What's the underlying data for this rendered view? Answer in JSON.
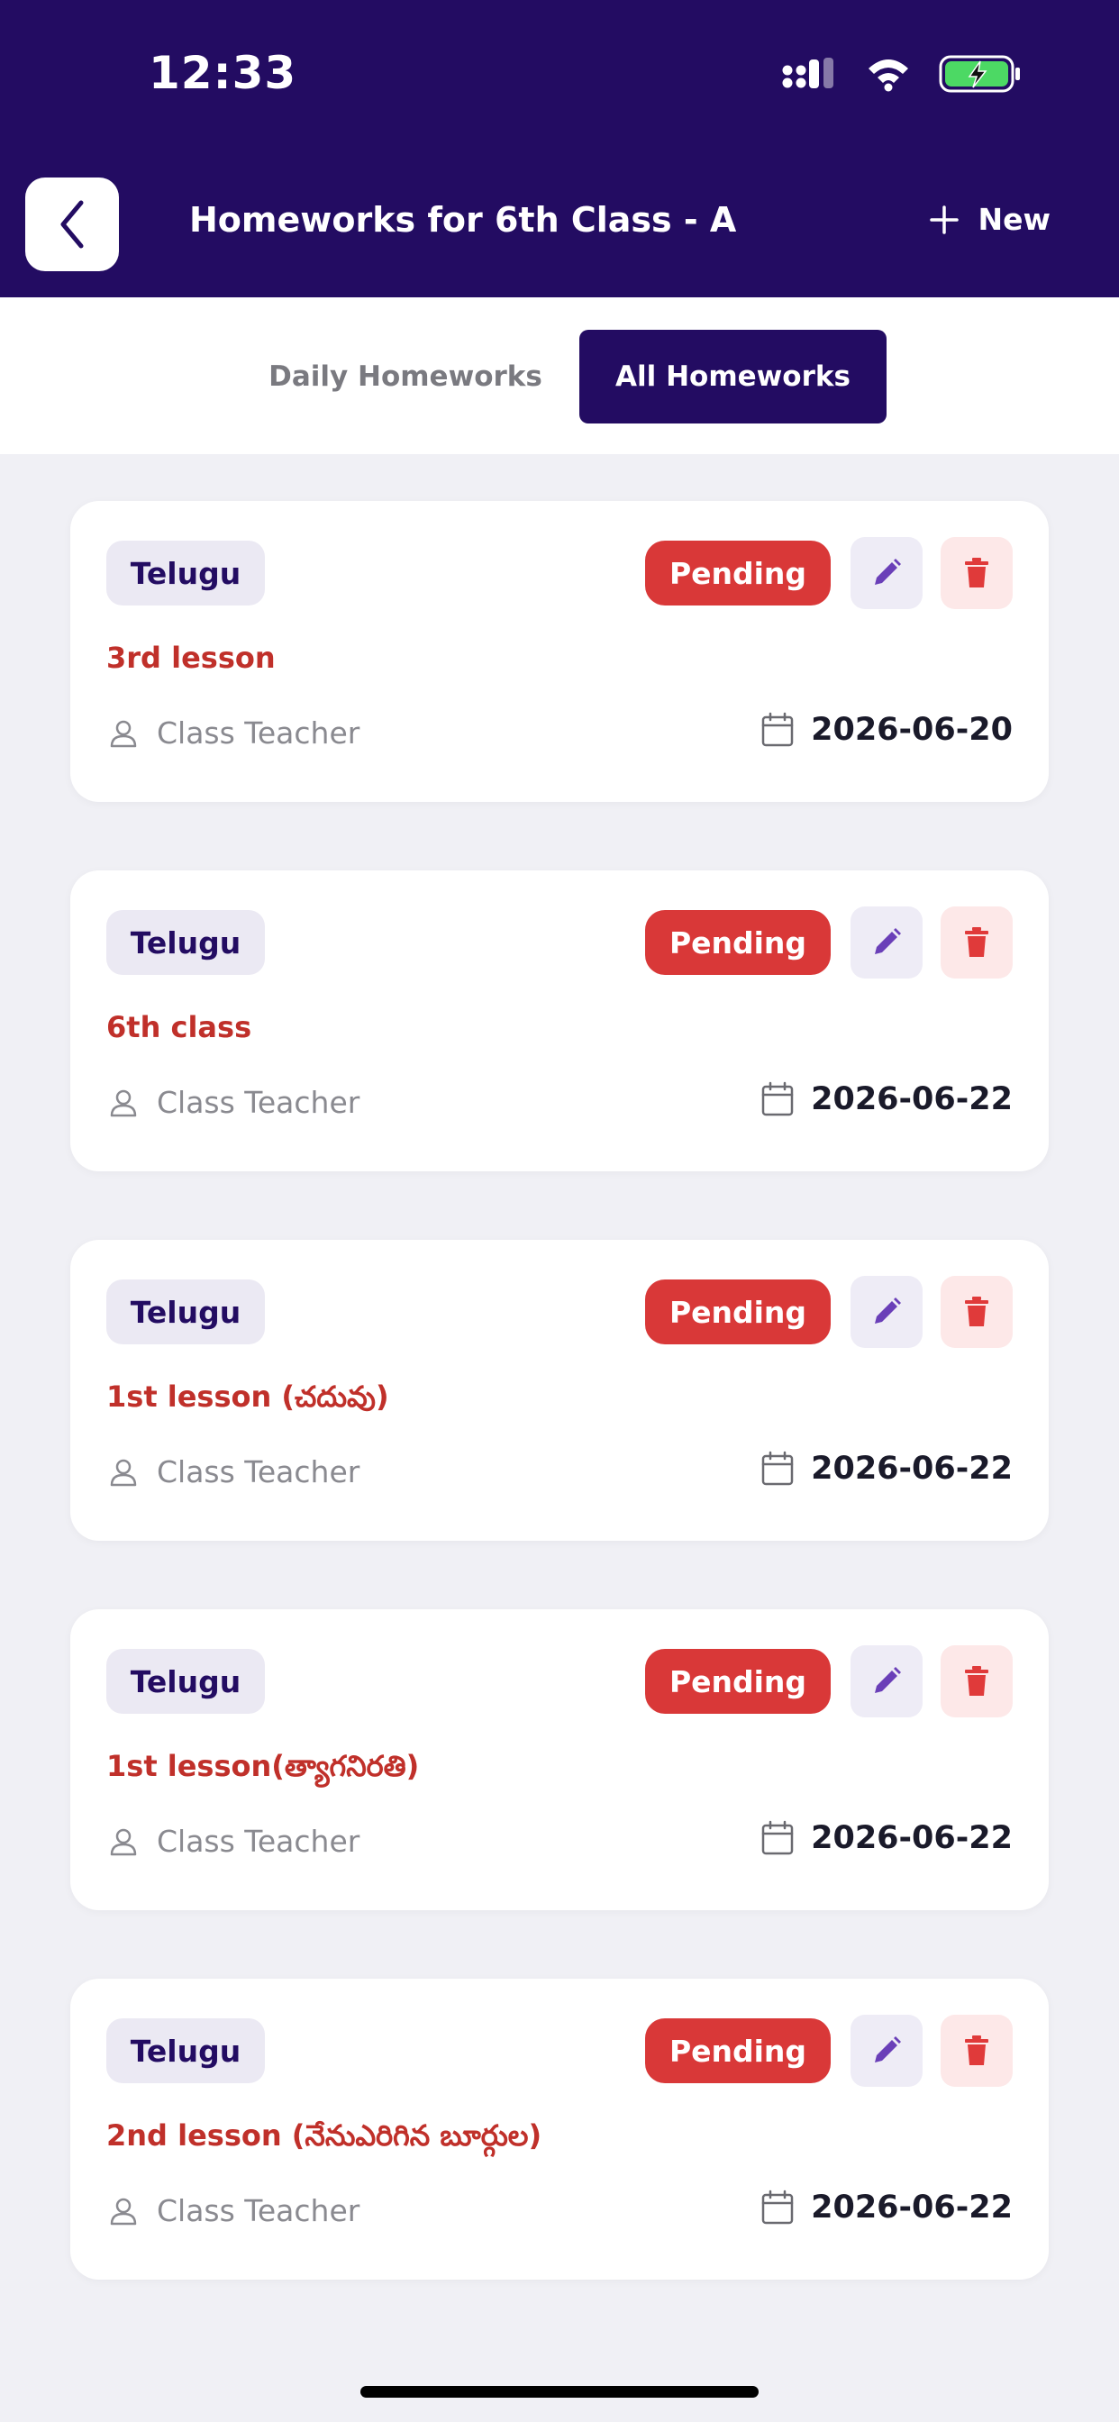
{
  "status_bar": {
    "time": "12:33"
  },
  "header": {
    "title": "Homeworks for 6th Class - A",
    "new_label": "New"
  },
  "tabs": [
    {
      "label": "Daily Homeworks",
      "active": false
    },
    {
      "label": "All Homeworks",
      "active": true
    }
  ],
  "homeworks": [
    {
      "subject": "Telugu",
      "status": "Pending",
      "title": "3rd lesson",
      "assigned_by": "Class Teacher",
      "due_date": "2026-06-20"
    },
    {
      "subject": "Telugu",
      "status": "Pending",
      "title": "6th class",
      "assigned_by": "Class Teacher",
      "due_date": "2026-06-22"
    },
    {
      "subject": "Telugu",
      "status": "Pending",
      "title": "1st lesson (చదువు)",
      "assigned_by": "Class Teacher",
      "due_date": "2026-06-22"
    },
    {
      "subject": "Telugu",
      "status": "Pending",
      "title": "1st lesson(త్యాగనిరతి)",
      "assigned_by": "Class Teacher",
      "due_date": "2026-06-22"
    },
    {
      "subject": "Telugu",
      "status": "Pending",
      "title": "2nd lesson (నేనుఎరిగిన బూర్గుల)",
      "assigned_by": "Class Teacher",
      "due_date": "2026-06-22"
    }
  ],
  "colors": {
    "header_bg": "#230c62",
    "page_bg": "#f0f0f5",
    "pending": "#d93838",
    "title_red": "#c0302a",
    "edit_icon": "#6a3fb8",
    "delete_icon": "#e03a3a"
  },
  "icons": {
    "back": "chevron-left-icon",
    "new": "plus-icon",
    "edit": "pencil-icon",
    "delete": "trash-icon",
    "teacher": "person-icon",
    "date": "calendar-icon"
  }
}
